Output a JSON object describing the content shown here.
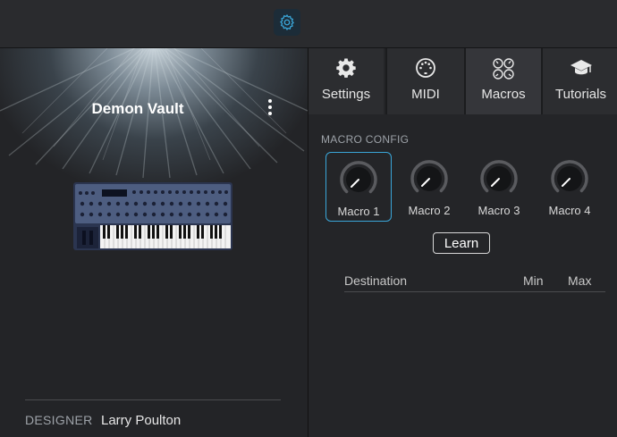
{
  "preset": {
    "title": "Demon Vault",
    "designer_label": "DESIGNER",
    "designer_value": "Larry Poulton"
  },
  "tabs": [
    {
      "label": "Settings",
      "icon": "gear-icon"
    },
    {
      "label": "MIDI",
      "icon": "midi-port-icon"
    },
    {
      "label": "Macros",
      "icon": "macro-knobs-icon",
      "active": true
    },
    {
      "label": "Tutorials",
      "icon": "graduation-cap-icon"
    }
  ],
  "macro_config": {
    "section_label": "MACRO CONFIG",
    "macros": [
      {
        "label": "Macro 1",
        "selected": true
      },
      {
        "label": "Macro 2"
      },
      {
        "label": "Macro 3"
      },
      {
        "label": "Macro 4"
      }
    ],
    "learn_label": "Learn",
    "columns": [
      "Destination",
      "Min",
      "Max"
    ]
  },
  "colors": {
    "accent": "#3aa6d8",
    "background": "#1f2022",
    "panel": "#242528"
  }
}
